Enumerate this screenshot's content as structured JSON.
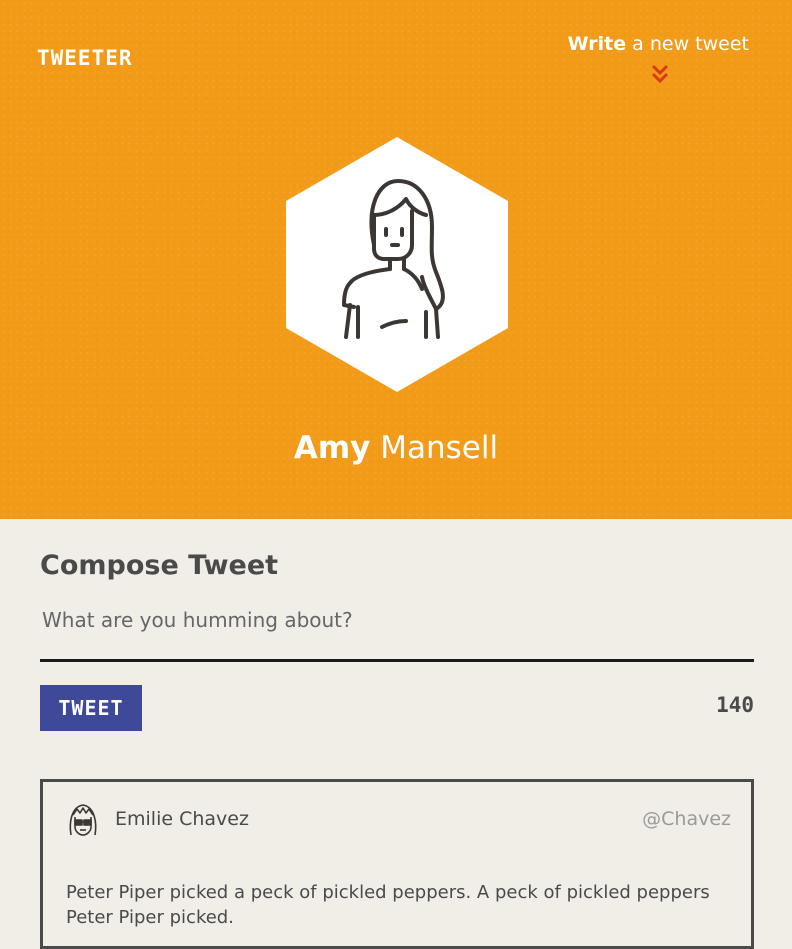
{
  "header": {
    "logo": "TWEETER",
    "write_bold": "Write",
    "write_rest": " a new tweet",
    "user_first": "Amy",
    "user_last": " Mansell",
    "icons": {
      "write_chevron": "double-chevron-down-icon",
      "avatar": "woman-avatar-icon"
    },
    "colors": {
      "background": "#f29b18",
      "chevron": "#d93b17"
    }
  },
  "compose": {
    "title": "Compose Tweet",
    "placeholder": "What are you humming about?",
    "button_label": "TWEET",
    "counter": "140",
    "colors": {
      "button": "#3e4a99"
    }
  },
  "tweets": [
    {
      "author": "Emilie Chavez",
      "handle": "@Chavez",
      "text": "Peter Piper picked a peck of pickled peppers. A peck of pickled peppers Peter Piper picked.",
      "avatar_icon": "girl-with-glasses-avatar-icon"
    }
  ]
}
